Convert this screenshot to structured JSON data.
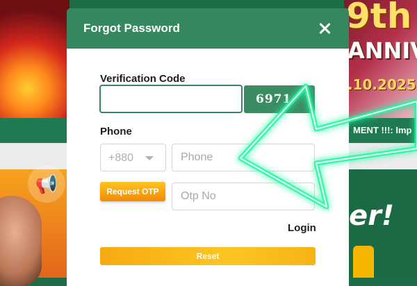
{
  "background": {
    "event_badge_big": "9th",
    "event_badge_line2": "ANNIV",
    "event_date": ".10.2025",
    "marquee": "MENT !!!: Imp",
    "promo_word": "er!"
  },
  "modal": {
    "title": "Forgot Password",
    "verification_label": "Verification Code",
    "verification_value": "",
    "captcha_code": "6971",
    "phone_label": "Phone",
    "country_code": "+880",
    "phone_placeholder": "Phone",
    "otp_button_label": "Request OTP",
    "otp_placeholder": "Otp No",
    "login_link": "Login",
    "reset_button_label": "Reset"
  },
  "colors": {
    "header": "#35885e",
    "captcha_bg": "#3c8c63",
    "otp_button": "#f6a314",
    "reset_button": "#fcc524",
    "neon_arrow": "#28f6a4"
  },
  "icons": {
    "close": "close-icon",
    "country_dropdown": "chevron-down-icon",
    "megaphone": "megaphone-icon"
  }
}
